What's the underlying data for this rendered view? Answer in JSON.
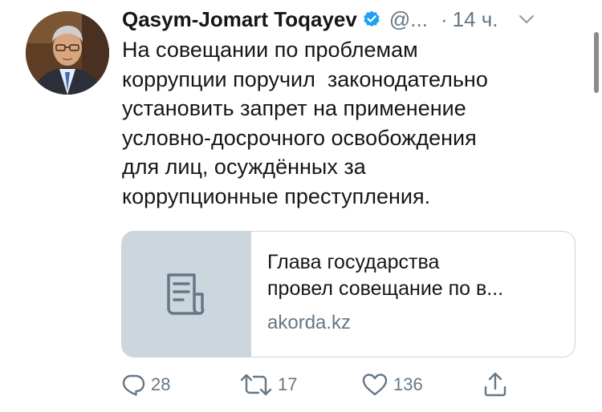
{
  "tweet": {
    "author_name": "Qasym-Jomart Toqayev",
    "handle": "@...",
    "separator": "·",
    "timestamp": "14 ч.",
    "text_lines": [
      "На совещании по проблемам",
      "коррупции поручил  законодательно",
      "установить запрет на применение",
      "условно-досрочного освобождения",
      "для лиц, осуждённых за",
      "коррупционные преступления."
    ]
  },
  "card": {
    "title_lines": [
      "Глава государства",
      "провел совещание по в..."
    ],
    "domain": "akorda.kz",
    "thumbnail_icon": "document-icon"
  },
  "actions": {
    "reply_count": "28",
    "retweet_count": "17",
    "like_count": "136"
  },
  "colors": {
    "text": "#14171a",
    "secondary": "#657786",
    "verified": "#1da1f2",
    "card_thumb_bg": "#ccd6dd",
    "border": "#ccd6dd"
  }
}
